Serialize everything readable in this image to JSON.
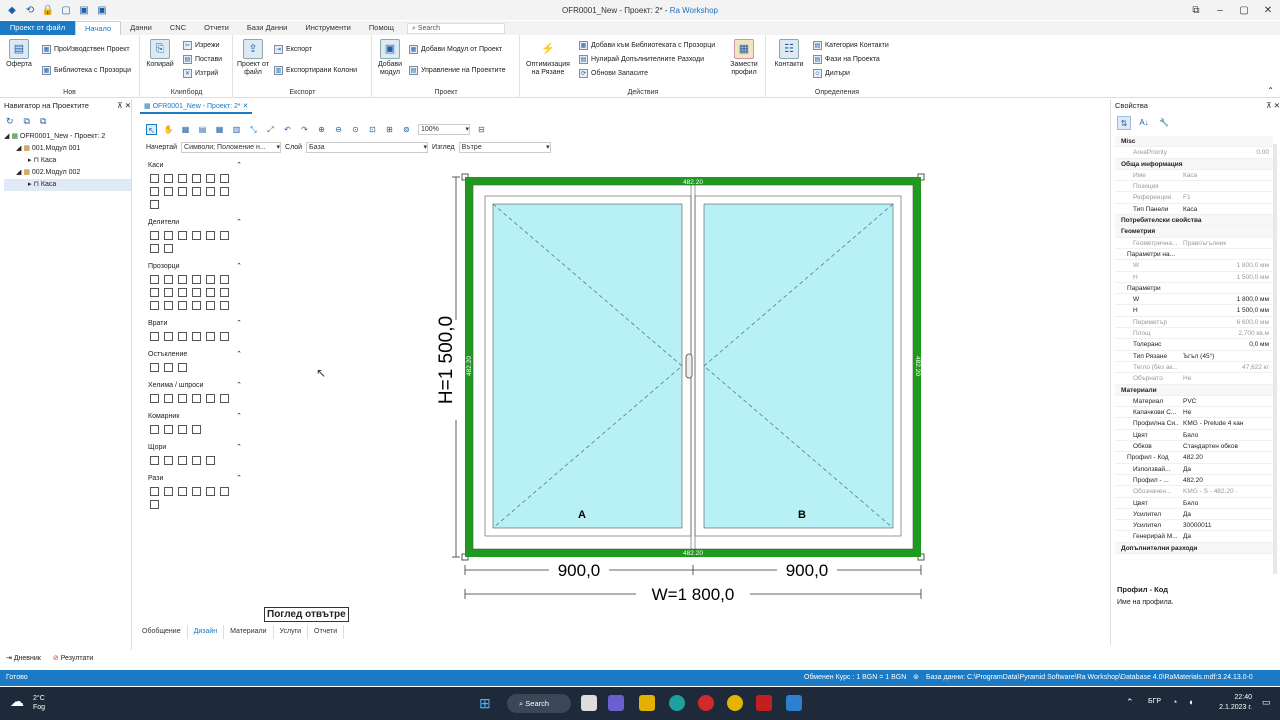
{
  "window": {
    "title_prefix": "OFR0001_New - Проект: 2* - ",
    "app_name": "Ra Workshop"
  },
  "ribbon_tabs": [
    "Проект от файл",
    "Начало",
    "Данни",
    "CNC",
    "Отчети",
    "Бази Данни",
    "Инструменти",
    "Помощ"
  ],
  "search_placeholder": "Search",
  "ribbon": {
    "nov": {
      "label": "Нов",
      "oferta": "Оферта",
      "proizv": "ПроИзводствен Проект",
      "biblio": "Библиотека с Прозорци"
    },
    "clipboard": {
      "label": "Клипборд",
      "kopirai": "Копирай",
      "izrezhi": "Изрежи",
      "postavi": "Постави",
      "iztrii": "Изтрий"
    },
    "export": {
      "label": "Експорт",
      "proekt": "Проект от файл",
      "eksport": "Експорт",
      "kolonii": "Експортирани Колони"
    },
    "proekt": {
      "label": "Проект",
      "dobavi": "Добави модул",
      "dobavi_modul": "Добави Модул от Проект",
      "upravlenie": "Управление на Проектите"
    },
    "deistvia": {
      "label": "Действия",
      "opt": "Оптимизация на Рязане",
      "dobavi_bib": "Добави към Библиотеката с Прозорци",
      "nulirai": "Нулирай Допълнителните Разходи",
      "obnovi": "Обнови Запасите",
      "zamesti": "Замести профил"
    },
    "opredelenia": {
      "label": "Определения",
      "kontakti": "Контакти",
      "kat": "Категория Контакти",
      "fazi": "Фази на Проекта",
      "dilari": "Дилъри"
    }
  },
  "left_panel": {
    "title": "Навигатор на Проектите",
    "tree": [
      "OFR0001_New - Проект: 2",
      "001.Модул 001",
      "Каса",
      "002.Модул 002",
      "Каса"
    ]
  },
  "doc_tab": "OFR0001_New - Проект: 2*",
  "toolbar": {
    "zoom": "100%"
  },
  "filters": {
    "draw_label": "Начертай",
    "draw_value": "Символи; Положение н...",
    "layer_label": "Слой",
    "layer_value": "База",
    "view_label": "Изглед",
    "view_value": "Вътре"
  },
  "palette": [
    {
      "title": "Каси",
      "count": 13
    },
    {
      "title": "Делители",
      "count": 8
    },
    {
      "title": "Прозорци",
      "count": 18
    },
    {
      "title": "Врати",
      "count": 6
    },
    {
      "title": "Остъкление",
      "count": 3
    },
    {
      "title": "Хелима / шпроси",
      "count": 6
    },
    {
      "title": "Комарник",
      "count": 4
    },
    {
      "title": "Щори",
      "count": 5
    },
    {
      "title": "Рази",
      "count": 7
    }
  ],
  "drawing": {
    "height_label": "H=1 500,0",
    "width_label": "W=1 800,0",
    "left_dim": "900,0",
    "right_dim": "900,0",
    "profile_top": "482.20",
    "profile_bottom": "482.20",
    "profile_left": "482.20",
    "profile_right": "482.20",
    "sash_a": "A",
    "sash_b": "B",
    "view_label": "Поглед отвътре",
    "frame_color": "#1f9a1f",
    "glass_color": "#b7f0f5"
  },
  "bottom_tabs": [
    "Обобщение",
    "Дизайн",
    "Материали",
    "Услуги",
    "Отчети"
  ],
  "right_panel": {
    "title": "Свойства",
    "rows": [
      {
        "type": "cat",
        "k": "Misc"
      },
      {
        "type": "dim",
        "k": "AreaPriority",
        "v": "0,00",
        "r": true
      },
      {
        "type": "cat",
        "k": "Обща информация"
      },
      {
        "type": "dim",
        "k": "Име",
        "v": "Каса"
      },
      {
        "type": "dim",
        "k": "Позиция",
        "v": ""
      },
      {
        "type": "dim",
        "k": "Референция",
        "v": "F1"
      },
      {
        "type": "norm",
        "k": "Тип Панели",
        "v": "Каса"
      },
      {
        "type": "cat",
        "k": "Потребителски свойства"
      },
      {
        "type": "cat",
        "k": "Геометрия"
      },
      {
        "type": "dim",
        "k": "Геометрична...",
        "v": "Правоъгълник"
      },
      {
        "type": "sub",
        "k": "Параметри на...",
        "v": ""
      },
      {
        "type": "dim",
        "k": "W",
        "v": "1 800,0 мм",
        "r": true
      },
      {
        "type": "dim",
        "k": "H",
        "v": "1 500,0 мм",
        "r": true
      },
      {
        "type": "sub",
        "k": "Параметри",
        "v": ""
      },
      {
        "type": "norm",
        "k": "W",
        "v": "1 800,0 мм",
        "r": true
      },
      {
        "type": "norm",
        "k": "H",
        "v": "1 500,0 мм",
        "r": true
      },
      {
        "type": "dim",
        "k": "Периметър",
        "v": "6 600,0 мм",
        "r": true
      },
      {
        "type": "dim",
        "k": "Площ",
        "v": "2,700 кв.м",
        "r": true
      },
      {
        "type": "norm",
        "k": "Толеранс",
        "v": "0,0 мм",
        "r": true
      },
      {
        "type": "norm",
        "k": "Тип Рязане",
        "v": "Ъгъл (45°)"
      },
      {
        "type": "dim",
        "k": "Тегло (без ак...",
        "v": "47,622 кг",
        "r": true
      },
      {
        "type": "dim",
        "k": "Обърнато",
        "v": "Не"
      },
      {
        "type": "cat",
        "k": "Материали"
      },
      {
        "type": "norm",
        "k": "Материал",
        "v": "PVC"
      },
      {
        "type": "norm",
        "k": "Капачкови С...",
        "v": "Не"
      },
      {
        "type": "norm",
        "k": "Профилна Си...",
        "v": "KMG - Prelude 4 кан"
      },
      {
        "type": "norm",
        "k": "Цвят",
        "v": "Бяло"
      },
      {
        "type": "norm",
        "k": "Обков",
        "v": "Стандартен обков"
      },
      {
        "type": "sub",
        "k": "Профил - Код",
        "v": "482.20"
      },
      {
        "type": "norm",
        "k": "Използвай...",
        "v": "Да"
      },
      {
        "type": "norm",
        "k": "Профил - ...",
        "v": "482.20"
      },
      {
        "type": "dim",
        "k": "Обозначен...",
        "v": "KMG - S - 482.20 -"
      },
      {
        "type": "norm",
        "k": "Цвят",
        "v": "Бяло"
      },
      {
        "type": "norm",
        "k": "Усилител",
        "v": "Да"
      },
      {
        "type": "norm",
        "k": "Усилител",
        "v": "30000011"
      },
      {
        "type": "norm",
        "k": "Генерирай М...",
        "v": "Да"
      },
      {
        "type": "cat",
        "k": "Допълнителни разходи"
      }
    ],
    "desc_title": "Профил - Код",
    "desc_text": "Име на профила."
  },
  "journal": {
    "dnevnik": "Дневник",
    "rezultati": "Резултати"
  },
  "status": {
    "left": "Готово",
    "kurs": "Обменен Курс : 1 BGN = 1 BGN",
    "db": "База данни: C:\\ProgramData\\Pyramid Software\\Ra Workshop\\Database 4.0\\RaMaterials.mdf:3.24.13.0-0"
  },
  "taskbar": {
    "temp": "2°C",
    "weather": "Fog",
    "search": "Search",
    "lang": "БГР",
    "time": "22:40",
    "date": "2.1.2023 г."
  }
}
